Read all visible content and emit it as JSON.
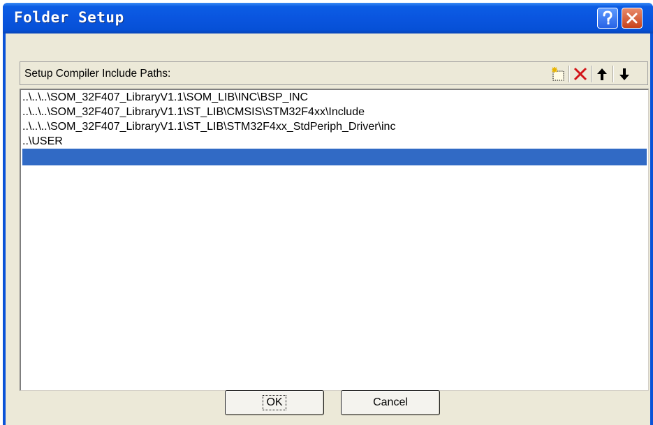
{
  "window": {
    "title": "Folder Setup",
    "help_icon": "help-icon",
    "close_icon": "close-icon"
  },
  "panel": {
    "label": "Setup Compiler Include Paths:",
    "toolbar": [
      {
        "name": "new-folder-icon"
      },
      {
        "name": "delete-icon"
      },
      {
        "name": "move-up-icon"
      },
      {
        "name": "move-down-icon"
      }
    ]
  },
  "paths": [
    "..\\..\\..\\SOM_32F407_LibraryV1.1\\SOM_LIB\\INC\\BSP_INC",
    "..\\..\\..\\SOM_32F407_LibraryV1.1\\ST_LIB\\CMSIS\\STM32F4xx\\Include",
    "..\\..\\..\\SOM_32F407_LibraryV1.1\\ST_LIB\\STM32F4xx_StdPeriph_Driver\\inc",
    "..\\USER",
    ""
  ],
  "buttons": {
    "ok": "OK",
    "cancel": "Cancel"
  },
  "colors": {
    "titlebar": "#0a55df",
    "selection": "#316ac5",
    "dialog_bg": "#ece9d8",
    "delete_red": "#d2161a"
  }
}
